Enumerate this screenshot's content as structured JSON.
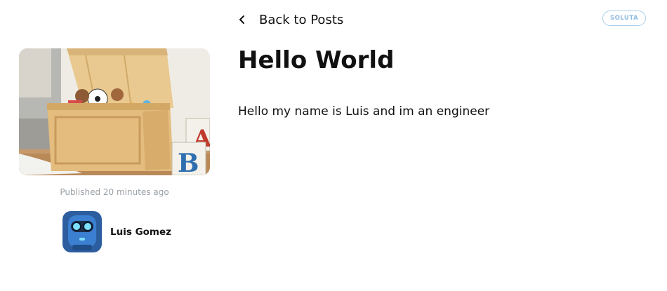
{
  "header": {
    "back_label": "Back to Posts",
    "badge_label": "SOLUTA"
  },
  "post": {
    "title": "Hello World",
    "body": "Hello my name is Luis and im an engineer",
    "published": "Published 20 minutes ago",
    "author_name": "Luis Gomez"
  },
  "icons": {
    "back": "chevron-left-icon",
    "hero_image": "toy-box-photo",
    "avatar": "robot-avatar"
  },
  "colors": {
    "badge_border": "#a9cde8",
    "badge_text": "#8fbbe0",
    "muted_text": "#9aa0a6",
    "text": "#111111"
  }
}
